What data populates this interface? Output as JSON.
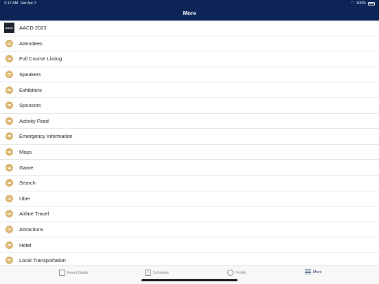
{
  "status": {
    "time": "2:17 AM",
    "date": "Sat Apr 2",
    "battery": "100%"
  },
  "header": {
    "title": "More"
  },
  "logo_text": "AACD",
  "items": [
    {
      "label": "AACD 2023",
      "type": "logo"
    },
    {
      "label": "Attendees",
      "icon": "attendees-icon"
    },
    {
      "label": "Full Course Listing",
      "icon": "course-list-icon"
    },
    {
      "label": "Speakers",
      "icon": "speakers-icon"
    },
    {
      "label": "Exhibitors",
      "icon": "exhibitors-icon"
    },
    {
      "label": "Sponsors",
      "icon": "sponsors-icon"
    },
    {
      "label": "Activity Feed",
      "icon": "activity-feed-icon"
    },
    {
      "label": "Emergency Information",
      "icon": "emergency-info-icon"
    },
    {
      "label": "Maps",
      "icon": "maps-icon"
    },
    {
      "label": "Game",
      "icon": "game-icon"
    },
    {
      "label": "Search",
      "icon": "search-icon"
    },
    {
      "label": "Uber",
      "icon": "uber-icon"
    },
    {
      "label": "Airline Travel",
      "icon": "airline-travel-icon"
    },
    {
      "label": "Attractions",
      "icon": "attractions-icon"
    },
    {
      "label": "Hotel",
      "icon": "hotel-icon"
    },
    {
      "label": "Local Transportation",
      "icon": "local-transportation-icon"
    }
  ],
  "tabs": [
    {
      "label": "Event Guide",
      "icon": "event-guide-icon",
      "active": false
    },
    {
      "label": "Schedule",
      "icon": "schedule-icon",
      "active": false
    },
    {
      "label": "Profile",
      "icon": "profile-icon",
      "active": false
    },
    {
      "label": "More",
      "icon": "more-icon",
      "active": true
    }
  ],
  "colors": {
    "header_bg": "#0c2456",
    "icon_gold": "#d9b36a",
    "active_tab": "#0c2456"
  }
}
